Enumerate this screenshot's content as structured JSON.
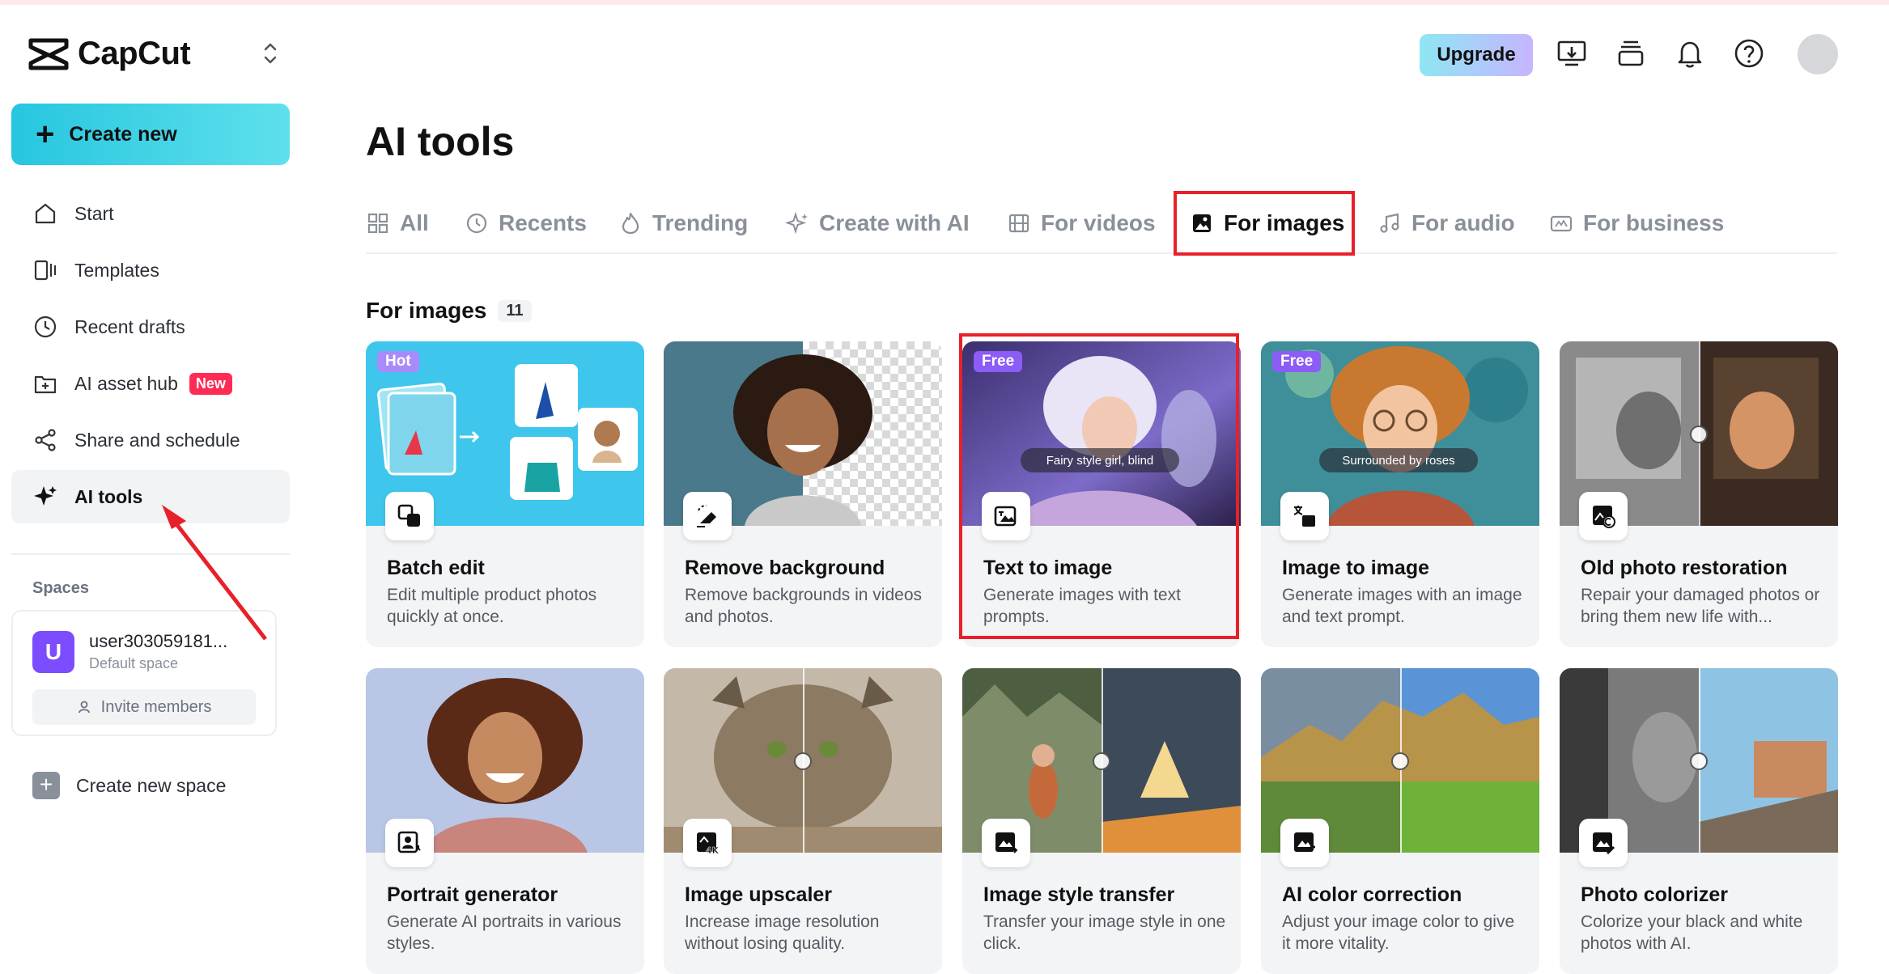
{
  "app": {
    "name": "CapCut"
  },
  "sidebar": {
    "create_label": "Create new",
    "items": [
      {
        "label": "Start",
        "icon": "home-icon"
      },
      {
        "label": "Templates",
        "icon": "templates-icon"
      },
      {
        "label": "Recent drafts",
        "icon": "clock-icon"
      },
      {
        "label": "AI asset hub",
        "icon": "asset-hub-icon",
        "badge": "New"
      },
      {
        "label": "Share and schedule",
        "icon": "share-icon"
      },
      {
        "label": "AI tools",
        "icon": "sparkle-icon",
        "active": true
      }
    ],
    "spaces_title": "Spaces",
    "space": {
      "avatar_letter": "U",
      "name": "user303059181...",
      "subtitle": "Default space",
      "invite_label": "Invite members"
    },
    "create_space_label": "Create new space"
  },
  "header": {
    "upgrade_label": "Upgrade",
    "icons": [
      "desktop-download-icon",
      "stack-icon",
      "bell-icon",
      "help-icon"
    ]
  },
  "main": {
    "title": "AI tools",
    "tabs": [
      {
        "label": "All",
        "icon": "grid-icon"
      },
      {
        "label": "Recents",
        "icon": "clock-icon"
      },
      {
        "label": "Trending",
        "icon": "flame-icon"
      },
      {
        "label": "Create with AI",
        "icon": "sparkle-icon"
      },
      {
        "label": "For videos",
        "icon": "film-icon"
      },
      {
        "label": "For images",
        "icon": "image-icon",
        "active": true
      },
      {
        "label": "For audio",
        "icon": "music-icon"
      },
      {
        "label": "For business",
        "icon": "business-icon"
      }
    ],
    "section": {
      "title": "For images",
      "count": "11"
    },
    "cards": [
      {
        "title": "Batch edit",
        "desc": "Edit multiple product photos quickly at once.",
        "tag": "Hot",
        "icon": "batch-edit-icon"
      },
      {
        "title": "Remove background",
        "desc": "Remove backgrounds in videos and photos.",
        "icon": "eraser-icon"
      },
      {
        "title": "Text to image",
        "desc": "Generate images with text prompts.",
        "tag": "Free",
        "prompt": "Fairy style girl, blind",
        "icon": "text-image-icon"
      },
      {
        "title": "Image to image",
        "desc": "Generate images with an image and text prompt.",
        "tag": "Free",
        "prompt": "Surrounded by roses",
        "icon": "image-translate-icon"
      },
      {
        "title": "Old photo restoration",
        "desc": "Repair your damaged photos or bring them new life with...",
        "icon": "photo-restore-icon"
      },
      {
        "title": "Portrait generator",
        "desc": "Generate AI portraits in various styles.",
        "icon": "portrait-icon"
      },
      {
        "title": "Image upscaler",
        "desc": "Increase image resolution without losing quality.",
        "icon": "upscale-4k-icon"
      },
      {
        "title": "Image style transfer",
        "desc": "Transfer your image style in one click.",
        "icon": "style-transfer-icon"
      },
      {
        "title": "AI color correction",
        "desc": "Adjust your image color to give it more vitality.",
        "icon": "color-correct-icon"
      },
      {
        "title": "Photo colorizer",
        "desc": "Colorize your black and white photos with AI.",
        "icon": "colorize-icon"
      }
    ]
  }
}
